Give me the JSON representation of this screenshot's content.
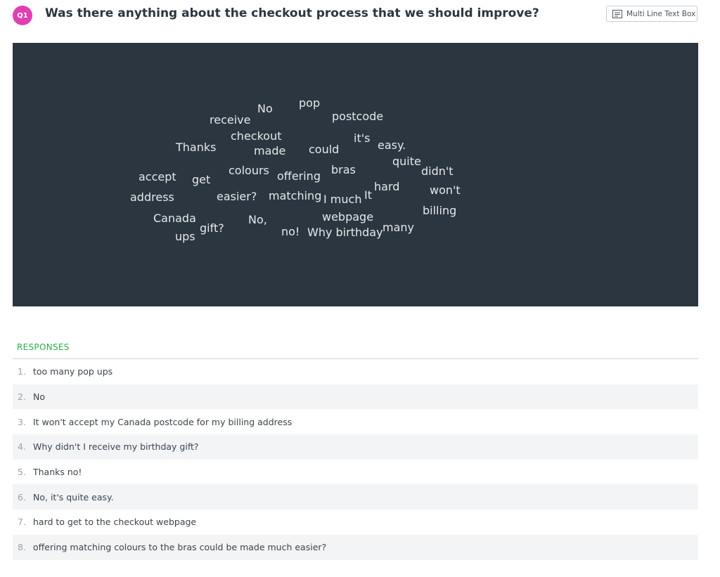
{
  "question": {
    "badge": "Q1",
    "title": "Was there anything about the checkout process that we should improve?",
    "type_label": "Multi Line Text Box"
  },
  "word_cloud": {
    "words": [
      "No",
      "pop",
      "receive",
      "postcode",
      "checkout",
      "it's",
      "Thanks",
      "made",
      "could",
      "easy.",
      "quite",
      "didn't",
      "accept",
      "get",
      "colours",
      "offering",
      "bras",
      "hard",
      "won't",
      "address",
      "easier?",
      "matching",
      "I much",
      "It",
      "billing",
      "Canada",
      "No,",
      "webpage",
      "gift?",
      "ups",
      "no!",
      "Why birthday",
      "many"
    ]
  },
  "responses": {
    "header": "RESPONSES",
    "items": [
      {
        "num": "1.",
        "text": "too many pop ups"
      },
      {
        "num": "2.",
        "text": "No"
      },
      {
        "num": "3.",
        "text": "It won't accept my Canada postcode for my billing address"
      },
      {
        "num": "4.",
        "text": "Why didn't I receive my birthday gift?"
      },
      {
        "num": "5.",
        "text": "Thanks no!"
      },
      {
        "num": "6.",
        "text": "No, it's quite easy."
      },
      {
        "num": "7.",
        "text": "hard to get to the checkout webpage"
      },
      {
        "num": "8.",
        "text": "offering matching colours to the bras could be made much easier?"
      }
    ]
  }
}
